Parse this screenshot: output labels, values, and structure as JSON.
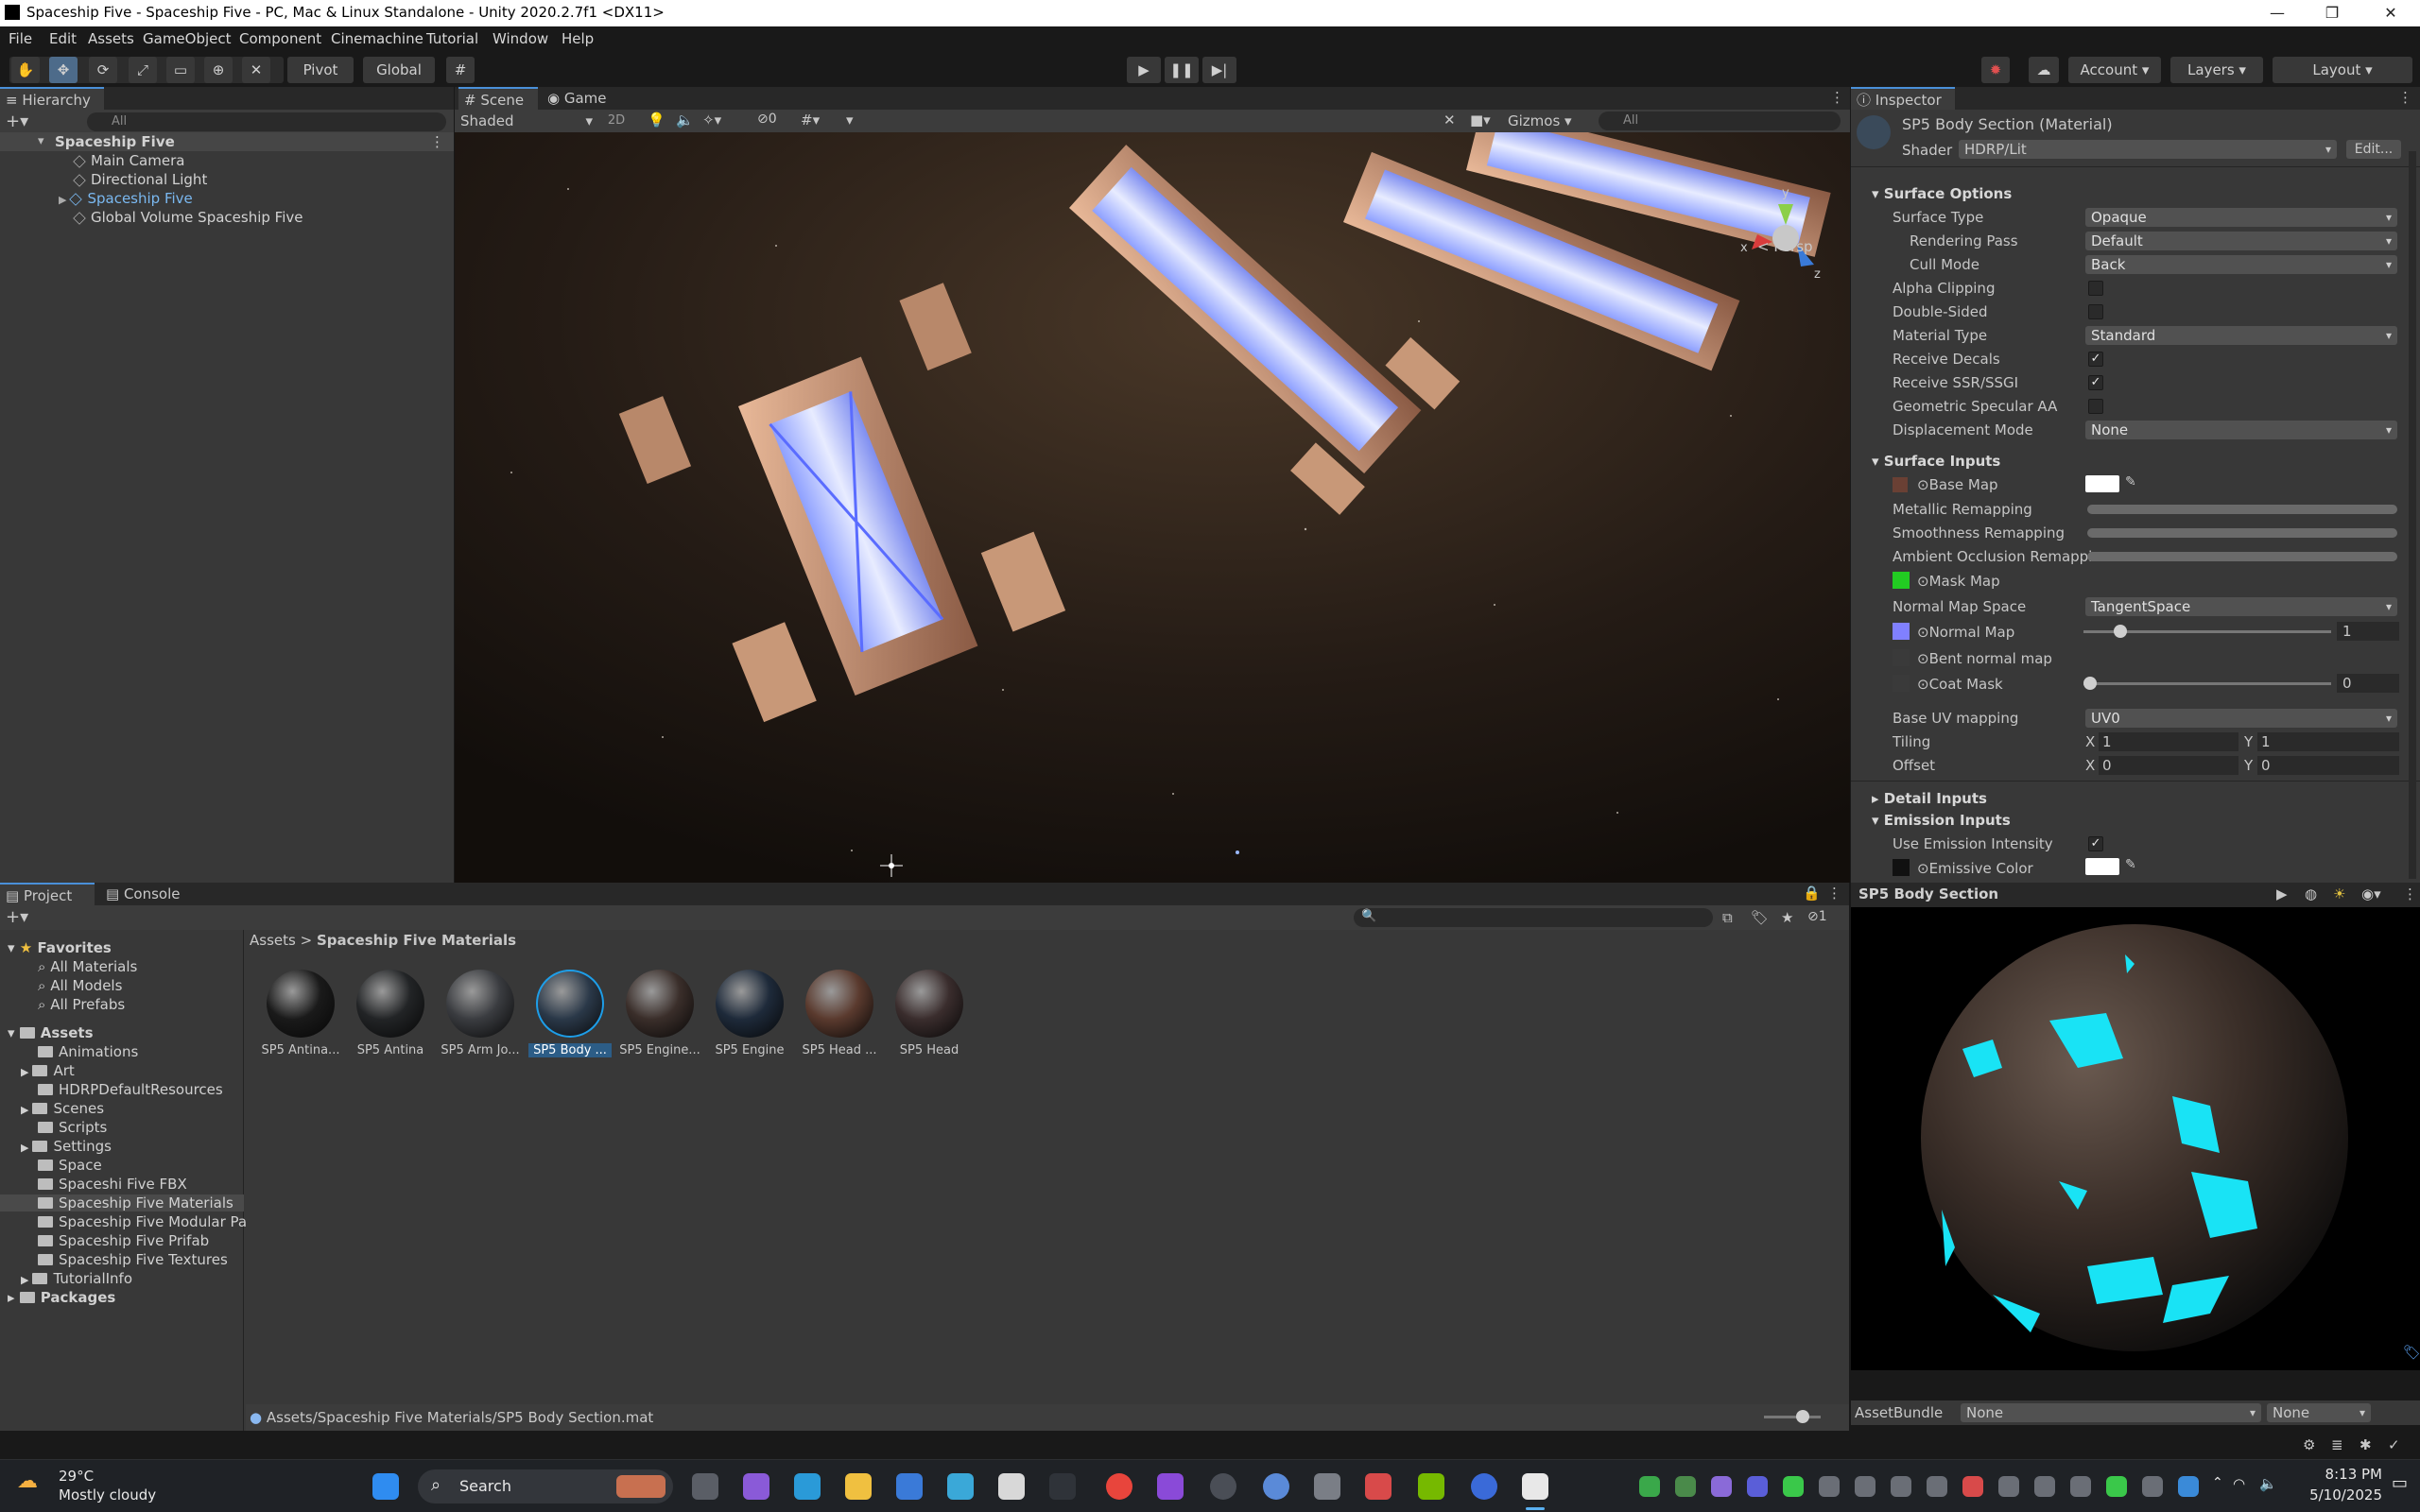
{
  "window": {
    "title": "Spaceship Five - Spaceship Five - PC, Mac & Linux Standalone - Unity 2020.2.7f1 <DX11>"
  },
  "menu": [
    "File",
    "Edit",
    "Assets",
    "GameObject",
    "Component",
    "Cinemachine",
    "Tutorial",
    "Window",
    "Help"
  ],
  "toolbar": {
    "pivot": "Pivot",
    "global": "Global",
    "account": "Account",
    "layers": "Layers",
    "layout": "Layout"
  },
  "hierarchy": {
    "tab": "Hierarchy",
    "search_placeholder": "All",
    "scene": "Spaceship Five",
    "items": [
      "Main Camera",
      "Directional Light",
      "Spaceship Five",
      "Global Volume Spaceship Five"
    ]
  },
  "scene": {
    "tabs": [
      "Scene",
      "Game"
    ],
    "shading": "Shaded",
    "two_d": "2D",
    "hidden_count": "0",
    "gizmos": "Gizmos",
    "search_placeholder": "All",
    "persp": "< Persp",
    "axis": {
      "x": "x",
      "y": "y",
      "z": "z"
    }
  },
  "inspector": {
    "tab": "Inspector",
    "material_name": "SP5 Body Section (Material)",
    "shader_label": "Shader",
    "shader_value": "HDRP/Lit",
    "edit_label": "Edit...",
    "surface_options": {
      "header": "Surface Options",
      "surface_type": {
        "label": "Surface Type",
        "value": "Opaque"
      },
      "rendering_pass": {
        "label": "Rendering Pass",
        "value": "Default"
      },
      "cull_mode": {
        "label": "Cull Mode",
        "value": "Back"
      },
      "alpha_clipping": {
        "label": "Alpha Clipping",
        "checked": false
      },
      "double_sided": {
        "label": "Double-Sided",
        "checked": false
      },
      "material_type": {
        "label": "Material Type",
        "value": "Standard"
      },
      "receive_decals": {
        "label": "Receive Decals",
        "checked": true
      },
      "receive_ssr": {
        "label": "Receive SSR/SSGI",
        "checked": true
      },
      "geometric_aa": {
        "label": "Geometric Specular AA",
        "checked": false
      },
      "displacement": {
        "label": "Displacement Mode",
        "value": "None"
      }
    },
    "surface_inputs": {
      "header": "Surface Inputs",
      "base_map": "Base Map",
      "metallic": "Metallic Remapping",
      "smoothness": "Smoothness Remapping",
      "ao": "Ambient Occlusion Remappi",
      "mask_map": "Mask Map",
      "normal_space": {
        "label": "Normal Map Space",
        "value": "TangentSpace"
      },
      "normal_map": {
        "label": "Normal Map",
        "value": "1",
        "level": 0.1
      },
      "bent_normal": "Bent normal map",
      "coat_mask": {
        "label": "Coat Mask",
        "value": "0",
        "level": 0
      },
      "base_uv": {
        "label": "Base UV mapping",
        "value": "UV0"
      },
      "tiling": {
        "label": "Tiling",
        "x": "1",
        "y": "1"
      },
      "offset": {
        "label": "Offset",
        "x": "0",
        "y": "0"
      },
      "x_label": "X",
      "y_label": "Y"
    },
    "detail_inputs": "Detail Inputs",
    "emission": {
      "header": "Emission Inputs",
      "use_intensity": {
        "label": "Use Emission Intensity",
        "checked": true
      },
      "color": "Emissive Color"
    },
    "preview_title": "SP5 Body Section",
    "asset_bundle": {
      "label": "AssetBundle",
      "value": "None",
      "variant": "None"
    }
  },
  "project": {
    "tabs": [
      "Project",
      "Console"
    ],
    "hidden_count": "1",
    "favorites": {
      "header": "Favorites",
      "items": [
        "All Materials",
        "All Models",
        "All Prefabs"
      ]
    },
    "assets": {
      "header": "Assets",
      "folders": [
        "Animations",
        "Art",
        "HDRPDefaultResources",
        "Scenes",
        "Scripts",
        "Settings",
        "Space",
        "Spaceshi Five FBX",
        "Spaceship Five Materials",
        "Spaceship Five Modular Pa",
        "Spaceship Five Prifab",
        "Spaceship Five Textures",
        "TutorialInfo"
      ]
    },
    "packages": "Packages",
    "breadcrumb": [
      "Assets",
      "Spaceship Five Materials"
    ],
    "items": [
      {
        "name": "SP5 Antina...",
        "color": "#1a1a1a"
      },
      {
        "name": "SP5 Antina",
        "color": "#222426"
      },
      {
        "name": "SP5 Arm Jo...",
        "color": "#3a3c40"
      },
      {
        "name": "SP5 Body ...",
        "color": "#2a3848"
      },
      {
        "name": "SP5 Engine...",
        "color": "#3a2e2a"
      },
      {
        "name": "SP5 Engine",
        "color": "#1e2a3a"
      },
      {
        "name": "SP5 Head ...",
        "color": "#5a3a2e"
      },
      {
        "name": "SP5 Head",
        "color": "#3a2d2d"
      }
    ],
    "status_path": "Assets/Spaceship Five Materials/SP5 Body Section.mat"
  },
  "taskbar": {
    "temp": "29°C",
    "weather": "Mostly cloudy",
    "search": "Search",
    "time": "8:13 PM",
    "date": "5/10/2025"
  }
}
